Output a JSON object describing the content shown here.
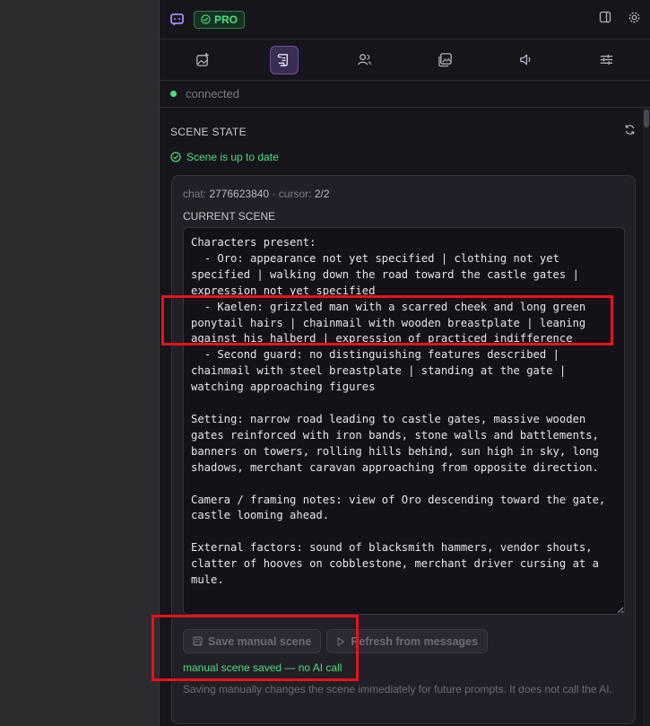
{
  "header": {
    "pro_label": "PRO"
  },
  "status": {
    "text": "connected"
  },
  "scene_state": {
    "title": "SCENE STATE",
    "up_to_date": "Scene is up to date"
  },
  "meta": {
    "chat_label": "chat:",
    "chat_id": "2776623840",
    "separator": "·",
    "cursor_label": "cursor:",
    "cursor_value": "2/2"
  },
  "current_scene": {
    "label": "CURRENT SCENE",
    "text": "Characters present:\n  - Oro: appearance not yet specified | clothing not yet specified | walking down the road toward the castle gates | expression not yet specified\n  - Kaelen: grizzled man with a scarred cheek and long green ponytail hairs | chainmail with wooden breastplate | leaning against his halberd | expression of practiced indifference\n  - Second guard: no distinguishing features described | chainmail with steel breastplate | standing at the gate | watching approaching figures\n\nSetting: narrow road leading to castle gates, massive wooden gates reinforced with iron bands, stone walls and battlements, banners on towers, rolling hills behind, sun high in sky, long shadows, merchant caravan approaching from opposite direction.\n\nCamera / framing notes: view of Oro descending toward the gate, castle looming ahead.\n\nExternal factors: sound of blacksmith hammers, vendor shouts, clatter of hooves on cobblestone, merchant driver cursing at a mule."
  },
  "buttons": {
    "save_manual": "Save manual scene",
    "refresh": "Refresh from messages"
  },
  "saved_message": "manual scene saved — no AI call",
  "help_text": "Saving manually changes the scene immediately for future prompts. It does not call the AI.",
  "colors": {
    "accent_green": "#4ade80",
    "active_tab": "#3a2d52",
    "annotation_red": "#e8121a"
  },
  "icons": [
    "chat-logo-icon",
    "check-circle-icon",
    "sidebar-toggle-icon",
    "gear-icon",
    "image-add-icon",
    "scroll-icon",
    "users-icon",
    "gallery-icon",
    "speaker-icon",
    "sliders-icon",
    "refresh-icon",
    "save-icon",
    "play-icon"
  ]
}
